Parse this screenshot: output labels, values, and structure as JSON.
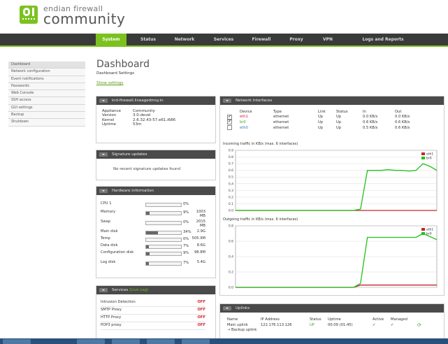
{
  "brand": {
    "top": "endian firewall",
    "main": "community"
  },
  "nav": {
    "tabs": [
      "System",
      "Status",
      "Network",
      "Services",
      "Firewall",
      "Proxy",
      "VPN",
      "Logs and Reports"
    ],
    "active": "System"
  },
  "sidebar": {
    "items": [
      "Dashboard",
      "Network configuration",
      "Event notifications",
      "Passwords",
      "Web Console",
      "SSH access",
      "GUI settings",
      "Backup",
      "Shutdown"
    ]
  },
  "page": {
    "title": "Dashboard",
    "subtitle": "Dashboard Settings",
    "show_settings": "Show settings"
  },
  "appliance_box": {
    "header": "krd-firewall.lineagedmsy.in",
    "rows": [
      {
        "label": "Appliance",
        "value": "Community"
      },
      {
        "label": "Version",
        "value": "3.0.devel"
      },
      {
        "label": "Kernel",
        "value": "2.6.32.43-57.e61.i686"
      },
      {
        "label": "Uptime",
        "value": "53m"
      }
    ]
  },
  "signature_box": {
    "header": "Signature updates",
    "message": "No recent signature updates found"
  },
  "hardware_box": {
    "header": "Hardware information",
    "rows": [
      {
        "label": "CPU 1",
        "percent": 0,
        "pct_text": "0%",
        "size": ""
      },
      {
        "label": "Memory",
        "percent": 9,
        "pct_text": "9%",
        "size": "1003 MB"
      },
      {
        "label": "Swap",
        "percent": 0,
        "pct_text": "0%",
        "size": "2015 MB"
      },
      {
        "label": "Main disk",
        "percent": 34,
        "pct_text": "34%",
        "size": "2.9G"
      },
      {
        "label": "Temp",
        "percent": 0,
        "pct_text": "0%",
        "size": "505.9M"
      },
      {
        "label": "Data disk",
        "percent": 7,
        "pct_text": "7%",
        "size": "8.6G"
      },
      {
        "label": "Configuration disk",
        "percent": 9,
        "pct_text": "9%",
        "size": "98.8M"
      },
      {
        "label": "Log disk",
        "percent": 7,
        "pct_text": "7%",
        "size": "5.4G"
      }
    ]
  },
  "services_box": {
    "header": "Services",
    "header_link": "(Live Log)",
    "items": [
      {
        "name": "Intrusion Detection",
        "state": "OFF"
      },
      {
        "name": "SMTP Proxy",
        "state": "OFF"
      },
      {
        "name": "HTTP Proxy",
        "state": "OFF"
      },
      {
        "name": "POP3 proxy",
        "state": "OFF"
      }
    ]
  },
  "network_box": {
    "header": "Network Interfaces",
    "columns": [
      "",
      "Device",
      "Type",
      "Link",
      "Status",
      "In",
      "Out"
    ],
    "rows": [
      {
        "checked": "✔",
        "device": "eth1",
        "type": "ethernet",
        "link": "Up",
        "status": "Up",
        "in": "0.0 KB/s",
        "out": "0.0 KB/s",
        "color": "#c0282d"
      },
      {
        "checked": "✔",
        "device": "br0",
        "type": "ethernet",
        "link": "Up",
        "status": "Up",
        "in": "0.6 KB/s",
        "out": "0.6 KB/s",
        "color": "#4aa515"
      },
      {
        "checked": "",
        "device": "eth0",
        "type": "ethernet",
        "link": "Up",
        "status": "Up",
        "in": "0.5 KB/s",
        "out": "0.6 KB/s",
        "color": "#2d7ab5"
      }
    ],
    "incoming_title": "Incoming traffic in KB/s (max. 6 interfaces)",
    "outgoing_title": "Outgoing traffic in KB/s (max. 6 interfaces)"
  },
  "chart_data": [
    {
      "type": "line",
      "title": "Incoming traffic in KB/s (max. 6 interfaces)",
      "x": [
        0,
        1,
        2,
        3,
        4,
        5,
        6,
        7,
        8,
        9,
        10,
        11,
        12,
        13,
        14,
        15,
        16,
        17,
        18,
        19,
        20,
        21,
        22,
        23,
        24,
        25,
        26,
        27,
        28,
        29
      ],
      "ylim": [
        0,
        0.9
      ],
      "yticks": [
        "0.9",
        "0.8",
        "0.7",
        "0.6",
        "0.5",
        "0.4",
        "0.3",
        "0.2",
        "0.1",
        "0.0"
      ],
      "series": [
        {
          "name": "eth1",
          "color": "#c0282d",
          "values": [
            0,
            0,
            0,
            0,
            0,
            0,
            0,
            0,
            0,
            0,
            0,
            0,
            0,
            0,
            0,
            0,
            0,
            0,
            0,
            0,
            0,
            0,
            0,
            0,
            0,
            0,
            0,
            0,
            0,
            0
          ]
        },
        {
          "name": "br0",
          "color": "#22c01a",
          "values": [
            0,
            0,
            0,
            0,
            0,
            0,
            0,
            0,
            0,
            0,
            0,
            0,
            0,
            0,
            0,
            0,
            0,
            0,
            0.02,
            0.6,
            0.6,
            0.6,
            0.61,
            0.6,
            0.6,
            0.59,
            0.6,
            0.7,
            0.66,
            0.6
          ]
        }
      ]
    },
    {
      "type": "line",
      "title": "Outgoing traffic in KB/s (max. 6 interfaces)",
      "x": [
        0,
        1,
        2,
        3,
        4,
        5,
        6,
        7,
        8,
        9,
        10,
        11,
        12,
        13,
        14,
        15,
        16,
        17,
        18,
        19,
        20,
        21,
        22,
        23,
        24,
        25,
        26,
        27,
        28,
        29
      ],
      "ylim": [
        0,
        0.8
      ],
      "yticks": [
        "0.8",
        "0.6",
        "0.4",
        "0.2",
        "0.0"
      ],
      "series": [
        {
          "name": "eth1",
          "color": "#c0282d",
          "values": [
            0,
            0,
            0,
            0,
            0,
            0,
            0,
            0,
            0,
            0,
            0,
            0,
            0,
            0,
            0,
            0,
            0,
            0,
            0.03,
            0.03,
            0.03,
            0.03,
            0.03,
            0.03,
            0.03,
            0.03,
            0.03,
            0.03,
            0.03,
            0.03
          ]
        },
        {
          "name": "br0",
          "color": "#22c01a",
          "values": [
            0,
            0,
            0,
            0,
            0,
            0,
            0,
            0,
            0,
            0,
            0,
            0,
            0,
            0,
            0,
            0,
            0,
            0,
            0.05,
            0.65,
            0.65,
            0.65,
            0.65,
            0.65,
            0.65,
            0.65,
            0.65,
            0.7,
            0.66,
            0.62
          ]
        }
      ]
    }
  ],
  "uplinks_box": {
    "header": "Uplinks",
    "columns": [
      "Name",
      "IP Address",
      "Status",
      "Uptime",
      "Active",
      "Managed"
    ],
    "row": {
      "name": "Main uplink",
      "ip": "122.176.113.126",
      "status": "UP",
      "uptime": "00:09 (01:45)",
      "active": "✔",
      "managed": "✔"
    },
    "backup": "→ Backup uplink"
  },
  "colors": {
    "accent": "#7bc21f",
    "nav_bg": "#3a3a3a",
    "off_red": "#d0242a"
  }
}
